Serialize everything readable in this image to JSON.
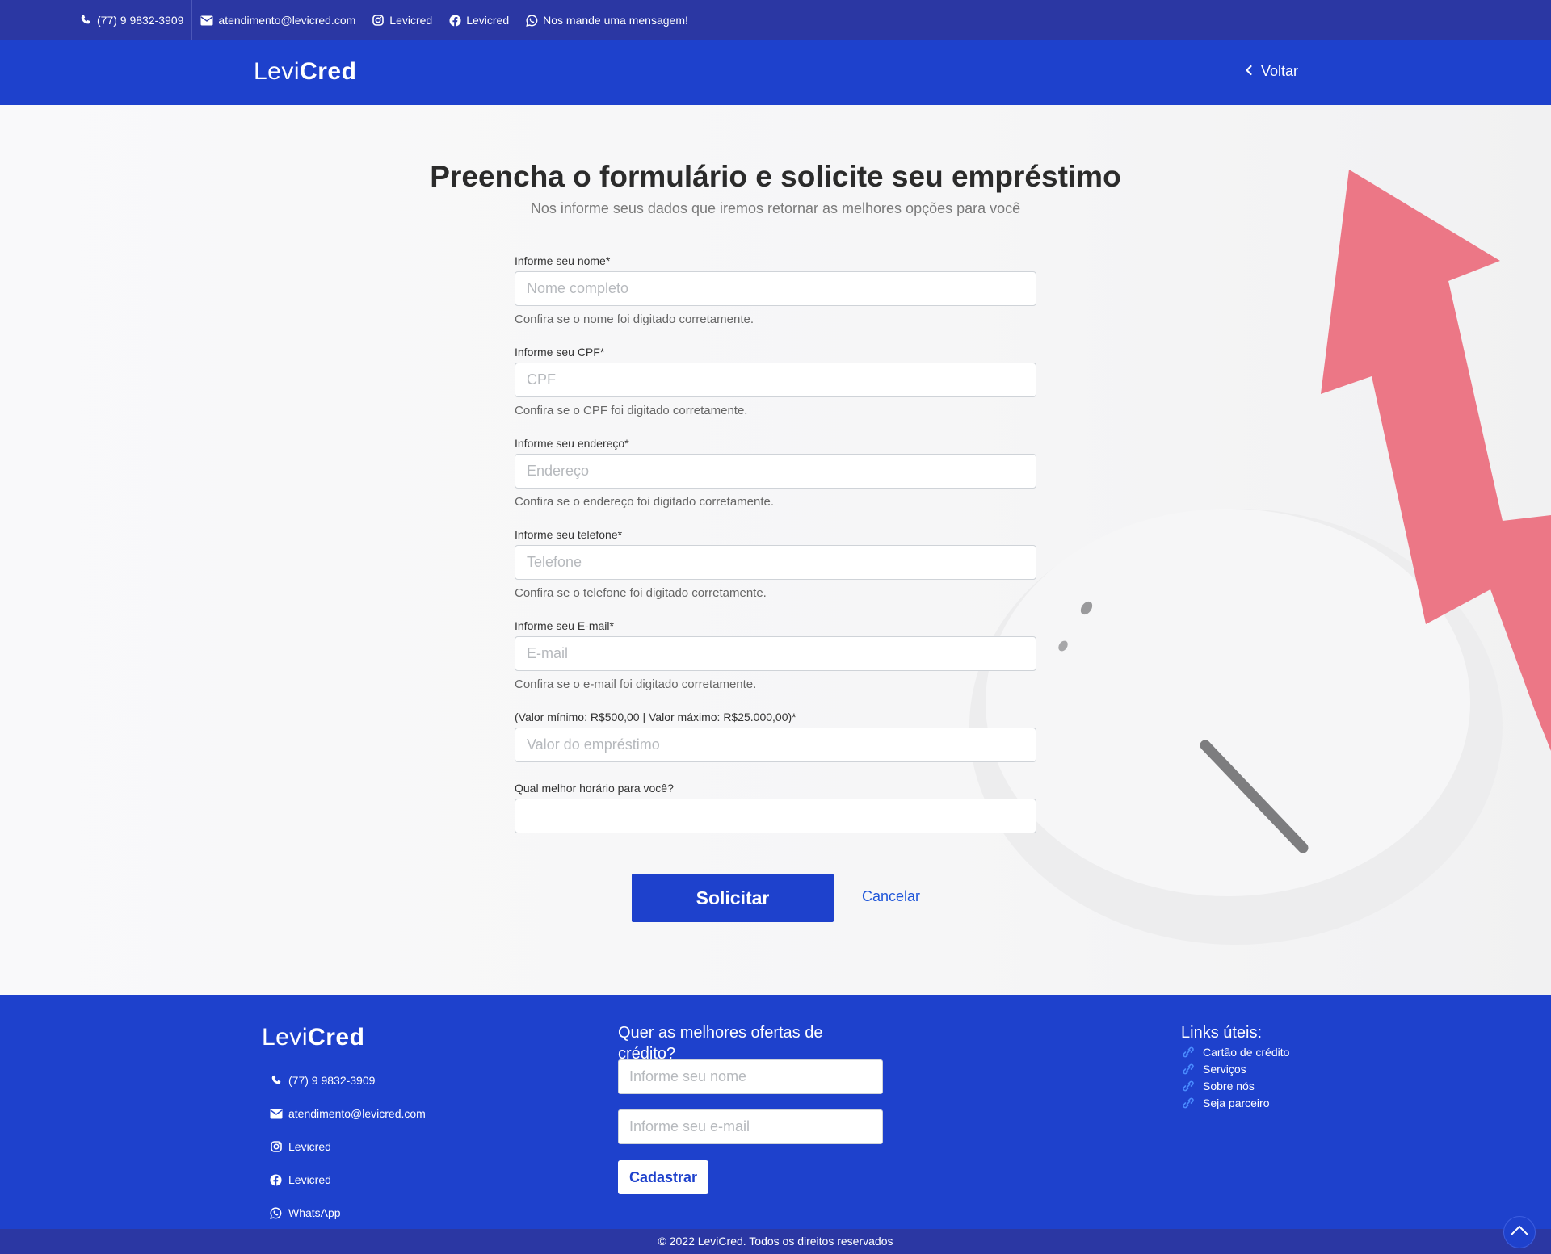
{
  "topbar": {
    "phone": "(77) 9 9832-3909",
    "email": "atendimento@levicred.com",
    "instagram": "Levicred",
    "facebook": "Levicred",
    "whatsapp": "Nos mande uma mensagem!"
  },
  "navbar": {
    "logo_light": "Levi",
    "logo_bold": "Cred",
    "back_label": "Voltar"
  },
  "main": {
    "title": "Preencha o formulário e solicite seu empréstimo",
    "subtitle": "Nos informe seus dados que iremos retornar as melhores opções para você",
    "fields": [
      {
        "label": "Informe seu nome*",
        "placeholder": "Nome completo",
        "value": "",
        "hint": "Confira se o nome foi digitado corretamente."
      },
      {
        "label": "Informe seu CPF*",
        "placeholder": "CPF",
        "value": "",
        "hint": "Confira se o CPF foi digitado corretamente."
      },
      {
        "label": "Informe seu endereço*",
        "placeholder": "Endereço",
        "value": "",
        "hint": "Confira se o endereço foi digitado corretamente."
      },
      {
        "label": "Informe seu telefone*",
        "placeholder": "Telefone",
        "value": "",
        "hint": "Confira se o telefone foi digitado corretamente."
      },
      {
        "label": "Informe seu E-mail*",
        "placeholder": "E-mail",
        "value": "",
        "hint": "Confira se o e-mail foi digitado corretamente."
      },
      {
        "label": "(Valor mínimo: R$500,00 | Valor máximo: R$25.000,00)*",
        "placeholder": "Valor do empréstimo",
        "value": ""
      },
      {
        "label": "Qual melhor horário para você?",
        "placeholder": "",
        "value": ""
      }
    ],
    "submit_label": "Solicitar",
    "cancel_label": "Cancelar"
  },
  "footer": {
    "logo_light": "Levi",
    "logo_bold": "Cred",
    "contacts": {
      "phone": "(77) 9 9832-3909",
      "email": "atendimento@levicred.com",
      "instagram": "Levicred",
      "facebook": "Levicred",
      "whatsapp": "WhatsApp"
    },
    "newsletter": {
      "heading": "Quer as melhores ofertas de crédito?",
      "name_placeholder": "Informe seu nome",
      "email_placeholder": "Informe seu e-mail",
      "button_label": "Cadastrar"
    },
    "links": {
      "heading": "Links úteis:",
      "items": [
        "Cartão de crédito",
        "Serviços",
        "Sobre nós",
        "Seja parceiro"
      ]
    },
    "copyright": "© 2022 LeviCred. Todos os direitos reservados"
  },
  "colors": {
    "topbar_bg": "#2b37a3",
    "brand_blue": "#1e41cc",
    "link_blue": "#1e55d9",
    "arrow_red": "#ec7786"
  },
  "icons": {
    "phone": "phone-icon",
    "email": "envelope-icon",
    "instagram": "instagram-icon",
    "facebook": "facebook-icon",
    "whatsapp": "whatsapp-icon",
    "back": "chevron-left-icon",
    "link": "link-icon",
    "to_top": "chevron-up-icon"
  }
}
